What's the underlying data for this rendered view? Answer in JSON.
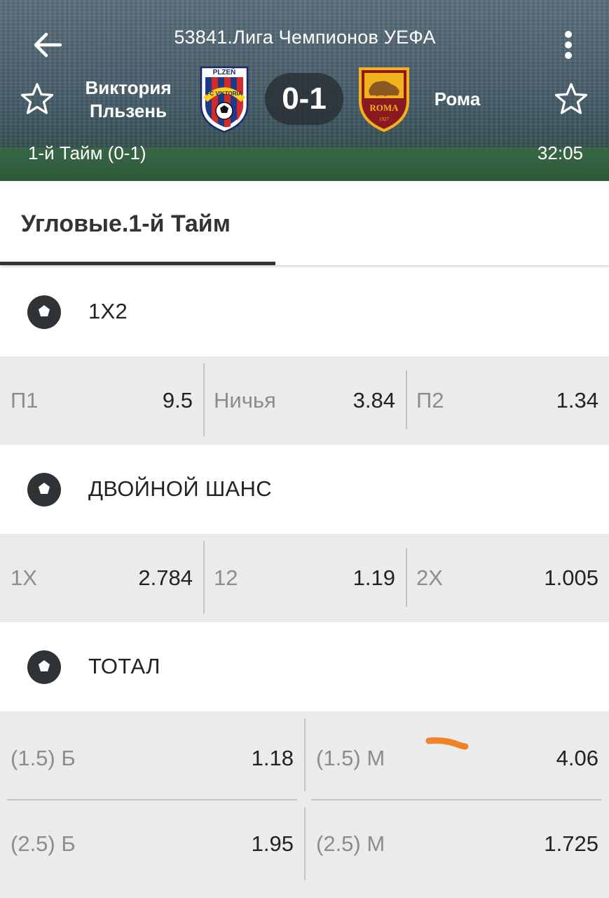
{
  "header": {
    "league": "53841.Лига Чемпионов УЕФА",
    "home_team_line1": "Виктория",
    "home_team_line2": "Пльзень",
    "away_team": "Рома",
    "score": "0-1",
    "period": "1-й  Тайм (0-1)",
    "clock": "32:05",
    "home_crest_text": "PLZEŇ",
    "home_crest_text2": "FC VIKTORIA",
    "away_crest_text": "ROMA",
    "away_crest_year": "1927"
  },
  "tab": {
    "label": "Угловые.1-й  Тайм"
  },
  "sections": {
    "one_x_two": {
      "title": "1X2",
      "cells": [
        {
          "label": "П1",
          "value": "9.5"
        },
        {
          "label": "Ничья",
          "value": "3.84"
        },
        {
          "label": "П2",
          "value": "1.34"
        }
      ]
    },
    "double_chance": {
      "title": "ДВОЙНОЙ ШАНС",
      "cells": [
        {
          "label": "1X",
          "value": "2.784"
        },
        {
          "label": "12",
          "value": "1.19"
        },
        {
          "label": "2X",
          "value": "1.005"
        }
      ]
    },
    "total": {
      "title": "ТОТАЛ",
      "rows": [
        [
          {
            "label": "(1.5) Б",
            "value": "1.18"
          },
          {
            "label": "(1.5) М",
            "value": "4.06"
          }
        ],
        [
          {
            "label": "(2.5) Б",
            "value": "1.95"
          },
          {
            "label": "(2.5) М",
            "value": "1.725"
          }
        ]
      ]
    }
  },
  "icons": {
    "back": "arrow-left-icon",
    "more": "more-vertical-icon",
    "favorite": "star-outline-icon",
    "section": "soccer-ball-icon"
  },
  "colors": {
    "odds_bg": "#ebebeb",
    "label_gray": "#8c8c8c",
    "tab_indicator": "#333333",
    "annotation": "#f0822a"
  }
}
